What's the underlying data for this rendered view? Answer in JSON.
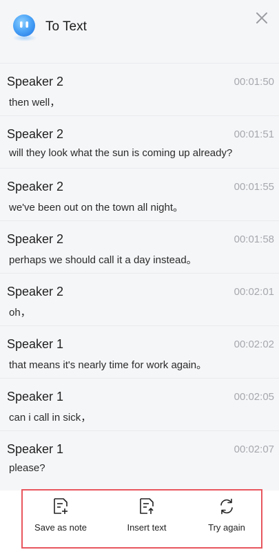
{
  "header": {
    "title": "To Text",
    "logo_icon": "assistant-face-icon",
    "close_icon": "close-icon",
    "accent": "#5aa9f5"
  },
  "transcript": [
    {
      "speaker": "Speaker 2",
      "time": "00:01:50",
      "text": "then well，"
    },
    {
      "speaker": "Speaker 2",
      "time": "00:01:51",
      "text": "will they look what the sun is coming up already?"
    },
    {
      "speaker": "Speaker 2",
      "time": "00:01:55",
      "text": "we've been out on the town all night。"
    },
    {
      "speaker": "Speaker 2",
      "time": "00:01:58",
      "text": "perhaps we should call it a day instead。"
    },
    {
      "speaker": "Speaker 2",
      "time": "00:02:01",
      "text": "oh，"
    },
    {
      "speaker": "Speaker 1",
      "time": "00:02:02",
      "text": "that means it's nearly time for work again。"
    },
    {
      "speaker": "Speaker 1",
      "time": "00:02:05",
      "text": "can i call in sick，"
    },
    {
      "speaker": "Speaker 1",
      "time": "00:02:07",
      "text": "please?"
    }
  ],
  "toolbar": {
    "save_label": "Save as note",
    "insert_label": "Insert text",
    "retry_label": "Try again",
    "highlight_color": "#e8565d"
  }
}
